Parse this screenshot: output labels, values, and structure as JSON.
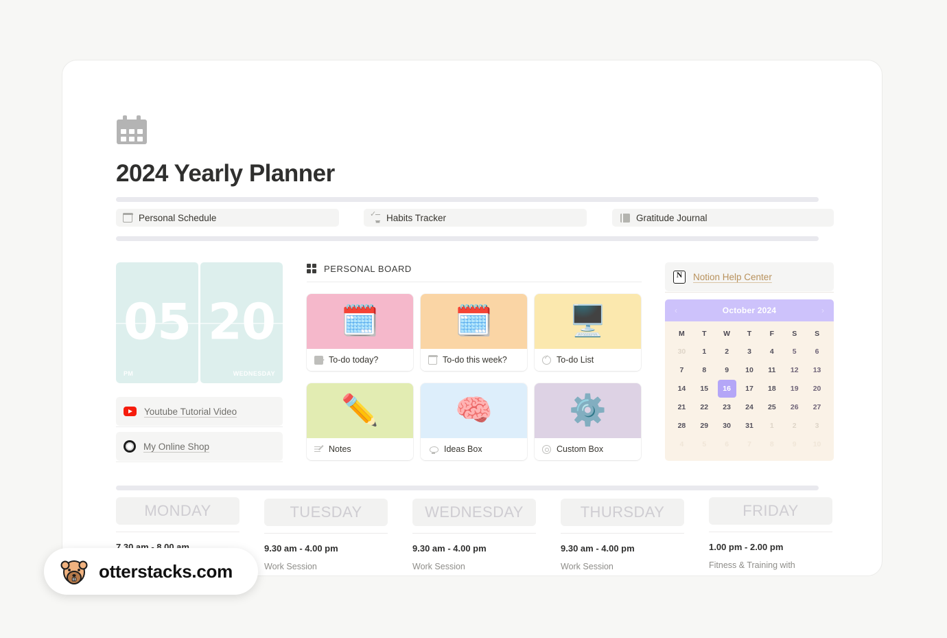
{
  "page": {
    "icon": "calendar-icon",
    "title": "2024 Yearly Planner"
  },
  "tabs": [
    {
      "label": "Personal Schedule",
      "icon": "calendar-icon"
    },
    {
      "label": "Habits Tracker",
      "icon": "checklist-icon"
    },
    {
      "label": "Gratitude Journal",
      "icon": "book-icon"
    }
  ],
  "clock": {
    "hours": "05",
    "minutes": "20",
    "meridiem": "PM",
    "weekday": "WEDNESDAY"
  },
  "left_links": [
    {
      "label": "Youtube Tutorial Video",
      "icon": "youtube-icon"
    },
    {
      "label": "My Online Shop",
      "icon": "shop-icon"
    }
  ],
  "board": {
    "title": "PERSONAL BOARD",
    "icon": "grid-icon",
    "cards": [
      {
        "label": "To-do today?",
        "emoji": "🗓️",
        "color": "#f5b8cb",
        "cap_icon": "film-icon"
      },
      {
        "label": "To-do this week?",
        "emoji": "🗓️",
        "color": "#fad5a5",
        "cap_icon": "calendar-icon"
      },
      {
        "label": "To-do List",
        "emoji": "🖥️",
        "color": "#fbe8ae",
        "cap_icon": "check-circle-icon"
      },
      {
        "label": "Notes",
        "emoji": "✏️",
        "color": "#e2ecb2",
        "cap_icon": "notes-icon"
      },
      {
        "label": "Ideas Box",
        "emoji": "🧠",
        "color": "#ddeefb",
        "cap_icon": "lightbulb-icon"
      },
      {
        "label": "Custom Box",
        "emoji": "⚙️",
        "color": "#ddd2e4",
        "cap_icon": "gear-icon"
      }
    ]
  },
  "help": {
    "label": "Notion Help Center",
    "icon": "notion-icon"
  },
  "calendar": {
    "month": "October 2024",
    "prev": "‹",
    "next": "›",
    "dow": [
      "M",
      "T",
      "W",
      "T",
      "F",
      "S",
      "S"
    ],
    "weeks": [
      [
        {
          "d": "30",
          "t": "muted"
        },
        {
          "d": "1",
          "t": ""
        },
        {
          "d": "2",
          "t": ""
        },
        {
          "d": "3",
          "t": ""
        },
        {
          "d": "4",
          "t": ""
        },
        {
          "d": "5",
          "t": "wknd"
        },
        {
          "d": "6",
          "t": "wknd"
        }
      ],
      [
        {
          "d": "7",
          "t": ""
        },
        {
          "d": "8",
          "t": ""
        },
        {
          "d": "9",
          "t": ""
        },
        {
          "d": "10",
          "t": ""
        },
        {
          "d": "11",
          "t": ""
        },
        {
          "d": "12",
          "t": "wknd"
        },
        {
          "d": "13",
          "t": "wknd"
        }
      ],
      [
        {
          "d": "14",
          "t": ""
        },
        {
          "d": "15",
          "t": ""
        },
        {
          "d": "16",
          "t": "today"
        },
        {
          "d": "17",
          "t": ""
        },
        {
          "d": "18",
          "t": ""
        },
        {
          "d": "19",
          "t": "wknd"
        },
        {
          "d": "20",
          "t": "wknd"
        }
      ],
      [
        {
          "d": "21",
          "t": ""
        },
        {
          "d": "22",
          "t": ""
        },
        {
          "d": "23",
          "t": ""
        },
        {
          "d": "24",
          "t": ""
        },
        {
          "d": "25",
          "t": ""
        },
        {
          "d": "26",
          "t": "wknd"
        },
        {
          "d": "27",
          "t": "wknd"
        }
      ],
      [
        {
          "d": "28",
          "t": ""
        },
        {
          "d": "29",
          "t": ""
        },
        {
          "d": "30",
          "t": ""
        },
        {
          "d": "31",
          "t": ""
        },
        {
          "d": "1",
          "t": "muted"
        },
        {
          "d": "2",
          "t": "muted"
        },
        {
          "d": "3",
          "t": "muted"
        }
      ],
      [
        {
          "d": "4",
          "t": "faded"
        },
        {
          "d": "5",
          "t": "faded"
        },
        {
          "d": "6",
          "t": "faded"
        },
        {
          "d": "7",
          "t": "faded"
        },
        {
          "d": "8",
          "t": "faded"
        },
        {
          "d": "9",
          "t": "faded"
        },
        {
          "d": "10",
          "t": "faded"
        }
      ]
    ],
    "today": "16"
  },
  "week": [
    {
      "day": "MONDAY",
      "time": "7.30 am - 8.00 am",
      "desc": ""
    },
    {
      "day": "TUESDAY",
      "time": "9.30 am - 4.00 pm",
      "desc": "Work Session"
    },
    {
      "day": "WEDNESDAY",
      "time": "9.30 am - 4.00 pm",
      "desc": "Work Session"
    },
    {
      "day": "THURSDAY",
      "time": "9.30 am - 4.00 pm",
      "desc": "Work Session"
    },
    {
      "day": "FRIDAY",
      "time": "1.00 pm - 2.00 pm",
      "desc": "Fitness & Training with"
    }
  ],
  "watermark": {
    "text": "otterstacks.com",
    "icon": "otter-logo"
  },
  "colors": {
    "accent_purple": "#cdc2fb",
    "today_purple": "#b4a6f7",
    "calendar_bg": "#faf2e7",
    "clock_teal": "#ddefed",
    "link_brown": "#b8915c",
    "youtube_red": "#f61c0d"
  }
}
